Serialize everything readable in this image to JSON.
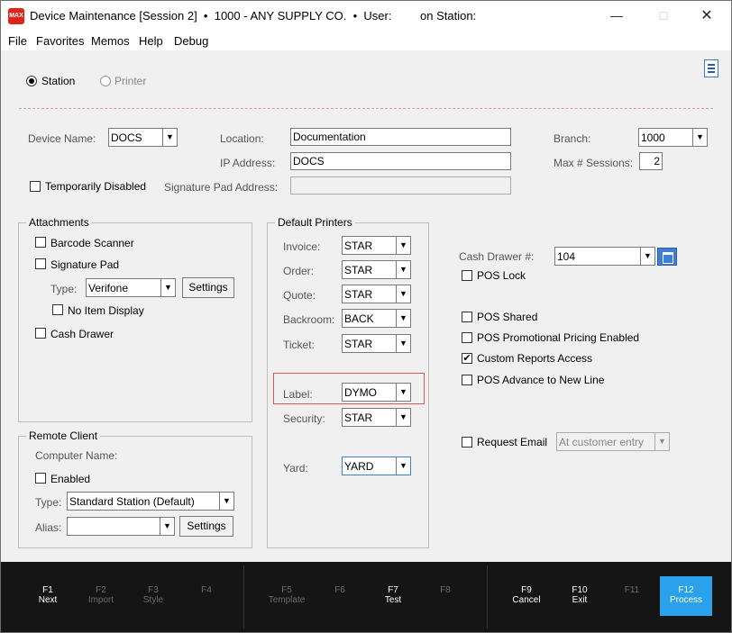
{
  "window": {
    "title": "Device Maintenance [Session 2]  •  1000 - ANY SUPPLY CO.  •  User:",
    "station_text": "on Station:",
    "app_icon": "MAX"
  },
  "menu": [
    "File",
    "Favorites",
    "Memos",
    "Help",
    "Debug"
  ],
  "mode": {
    "station_label": "Station",
    "printer_label": "Printer",
    "selected": "Station"
  },
  "device": {
    "name_label": "Device Name:",
    "name": "DOCS",
    "location_label": "Location:",
    "location": "Documentation",
    "ip_label": "IP Address:",
    "ip": "DOCS",
    "branch_label": "Branch:",
    "branch": "1000",
    "max_sessions_label": "Max # Sessions:",
    "max_sessions": "2",
    "temp_disabled_label": "Temporarily Disabled",
    "sig_pad_addr_label": "Signature Pad Address:",
    "sig_pad_addr": ""
  },
  "attachments": {
    "title": "Attachments",
    "barcode_label": "Barcode Scanner",
    "sigpad_label": "Signature Pad",
    "type_label": "Type:",
    "type_value": "Verifone",
    "settings_label": "Settings",
    "no_item_label": "No Item Display",
    "cash_drawer_label": "Cash Drawer"
  },
  "remote": {
    "title": "Remote Client",
    "computer_label": "Computer Name:",
    "enabled_label": "Enabled",
    "type_label": "Type:",
    "type_value": "Standard Station (Default)",
    "alias_label": "Alias:",
    "alias_value": "",
    "settings_label": "Settings"
  },
  "printers": {
    "title": "Default Printers",
    "invoice_label": "Invoice:",
    "invoice": "STAR",
    "order_label": "Order:",
    "order": "STAR",
    "quote_label": "Quote:",
    "quote": "STAR",
    "backroom_label": "Backroom:",
    "backroom": "BACK",
    "ticket_label": "Ticket:",
    "ticket": "STAR",
    "label_label": "Label:",
    "label": "DYMO",
    "security_label": "Security:",
    "security": "STAR",
    "yard_label": "Yard:",
    "yard": "YARD"
  },
  "pos": {
    "cash_drawer_label": "Cash Drawer #:",
    "cash_drawer": "104",
    "lock_label": "POS Lock",
    "shared_label": "POS Shared",
    "promo_label": "POS Promotional Pricing Enabled",
    "custom_reports_label": "Custom Reports Access",
    "advance_label": "POS Advance to New Line",
    "request_email_label": "Request Email",
    "email_option": "At customer entry",
    "check_mark": "✔"
  },
  "fkeys": {
    "f1": {
      "k": "F1",
      "n": "Next"
    },
    "f2": {
      "k": "F2",
      "n": "Import"
    },
    "f3": {
      "k": "F3",
      "n": "Style"
    },
    "f4": {
      "k": "F4",
      "n": ""
    },
    "f5": {
      "k": "F5",
      "n": "Template"
    },
    "f6": {
      "k": "F6",
      "n": ""
    },
    "f7": {
      "k": "F7",
      "n": "Test"
    },
    "f8": {
      "k": "F8",
      "n": ""
    },
    "f9": {
      "k": "F9",
      "n": "Cancel"
    },
    "f10": {
      "k": "F10",
      "n": "Exit"
    },
    "f11": {
      "k": "F11",
      "n": ""
    },
    "f12": {
      "k": "F12",
      "n": "Process"
    }
  },
  "colors": {
    "accent": "#2aa1ea",
    "highlight": "#e05454",
    "footer": "#151515"
  }
}
